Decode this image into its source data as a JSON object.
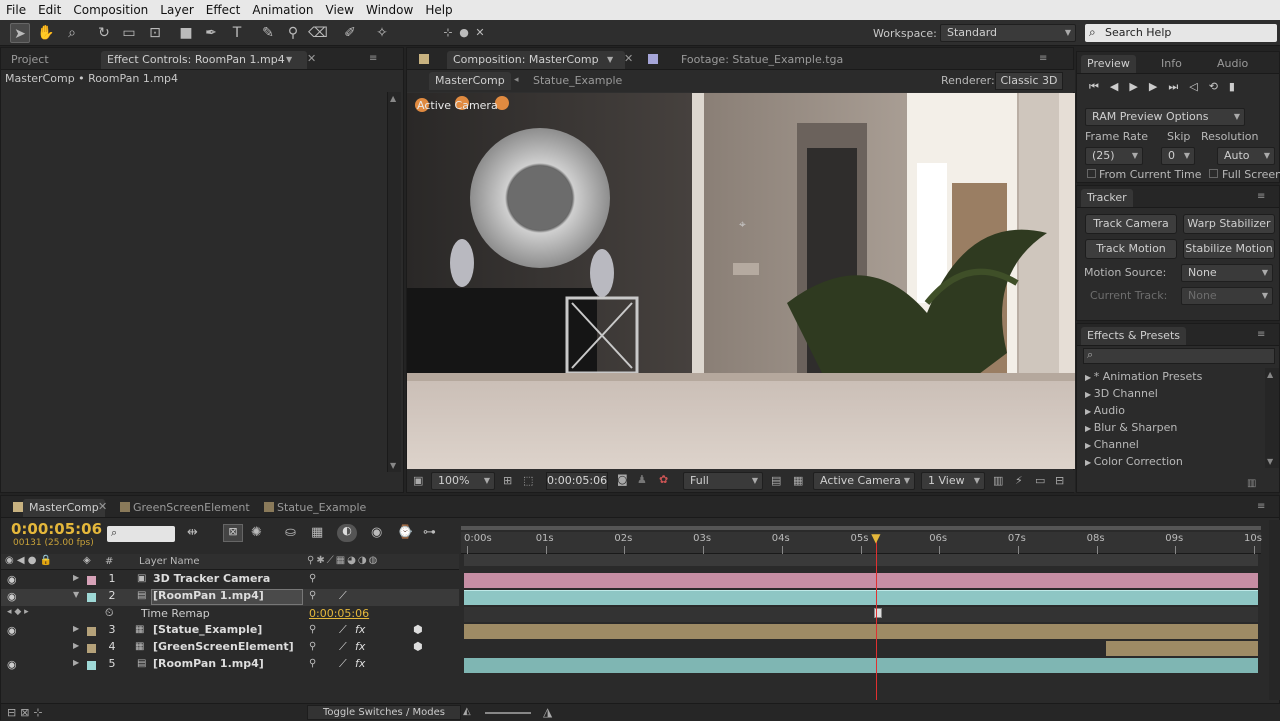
{
  "menu": [
    "File",
    "Edit",
    "Composition",
    "Layer",
    "Effect",
    "Animation",
    "View",
    "Window",
    "Help"
  ],
  "workspace": {
    "label": "Workspace:",
    "value": "Standard"
  },
  "search_help": "Search Help",
  "left_panel": {
    "tabs": [
      "Project",
      "Effect Controls: RoomPan 1.mp4"
    ],
    "breadcrumb": "MasterComp • RoomPan 1.mp4"
  },
  "comp_panel": {
    "tabs": [
      "Composition: MasterComp",
      "Footage: Statue_Example.tga"
    ],
    "subtabs": [
      "MasterComp",
      "Statue_Example"
    ],
    "renderer_label": "Renderer:",
    "renderer": "Classic 3D",
    "viewer_label": "Active Camera",
    "zoom": "100%",
    "timecode": "0:00:05:06",
    "resolution": "Full",
    "camera": "Active Camera",
    "views": "1 View"
  },
  "preview": {
    "tabs": [
      "Preview",
      "Info",
      "Audio"
    ],
    "ram_options": "RAM Preview Options",
    "frame_rate_label": "Frame Rate",
    "skip_label": "Skip",
    "resolution_label": "Resolution",
    "frame_rate": "(25)",
    "skip": "0",
    "resolution": "Auto",
    "from_current": "From Current Time",
    "full_screen": "Full Screen"
  },
  "tracker": {
    "title": "Tracker",
    "buttons": [
      "Track Camera",
      "Warp Stabilizer",
      "Track Motion",
      "Stabilize Motion"
    ],
    "motion_source_label": "Motion Source:",
    "motion_source": "None",
    "current_track_label": "Current Track:",
    "current_track": "None"
  },
  "effects": {
    "title": "Effects & Presets",
    "items": [
      "* Animation Presets",
      "3D Channel",
      "Audio",
      "Blur & Sharpen",
      "Channel",
      "Color Correction"
    ]
  },
  "timeline": {
    "tabs": [
      "MasterComp",
      "GreenScreenElement",
      "Statue_Example"
    ],
    "timecode": "0:00:05:06",
    "frame_info": "00131 (25.00 fps)",
    "col_hash": "#",
    "col_layer_name": "Layer Name",
    "ruler": [
      "0:00s",
      "01s",
      "02s",
      "03s",
      "04s",
      "05s",
      "06s",
      "07s",
      "08s",
      "09s",
      "10s"
    ],
    "layers": [
      {
        "num": "1",
        "name": "3D Tracker Camera",
        "color": "#d7a2b8"
      },
      {
        "num": "2",
        "name": "[RoomPan 1.mp4]",
        "color": "#9ed8d6"
      },
      {
        "num": "3",
        "name": "[Statue_Example]",
        "color": "#b5a27a"
      },
      {
        "num": "4",
        "name": "[GreenScreenElement]",
        "color": "#b5a27a"
      },
      {
        "num": "5",
        "name": "[RoomPan 1.mp4]",
        "color": "#9ed8d6"
      }
    ],
    "time_remap_label": "Time Remap",
    "time_remap_value": "0:00:05:06",
    "toggle_label": "Toggle Switches / Modes",
    "playhead_seconds": 5.2
  }
}
